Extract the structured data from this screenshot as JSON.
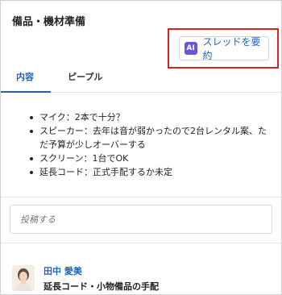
{
  "page": {
    "title": "備品・機材準備"
  },
  "summary_button": {
    "icon_text": "AI",
    "label": "スレッドを要約"
  },
  "tabs": [
    {
      "label": "内容",
      "active": true
    },
    {
      "label": "ピープル",
      "active": false
    }
  ],
  "content": {
    "items": [
      "マイク：2本で十分？",
      "スピーカー：去年は音が弱かったので2台レンタル案、ただ予算が少しオーバーする",
      "スクリーン：1台でOK",
      "延長コード：正式手配するか未定"
    ]
  },
  "post": {
    "placeholder": "投稿する"
  },
  "thread": {
    "author": "田中 愛美",
    "title": "延長コード・小物備品の手配"
  },
  "colors": {
    "accent": "#1f63b8",
    "ai_badge": "#6a55e0",
    "highlight_border": "#e0201e"
  }
}
